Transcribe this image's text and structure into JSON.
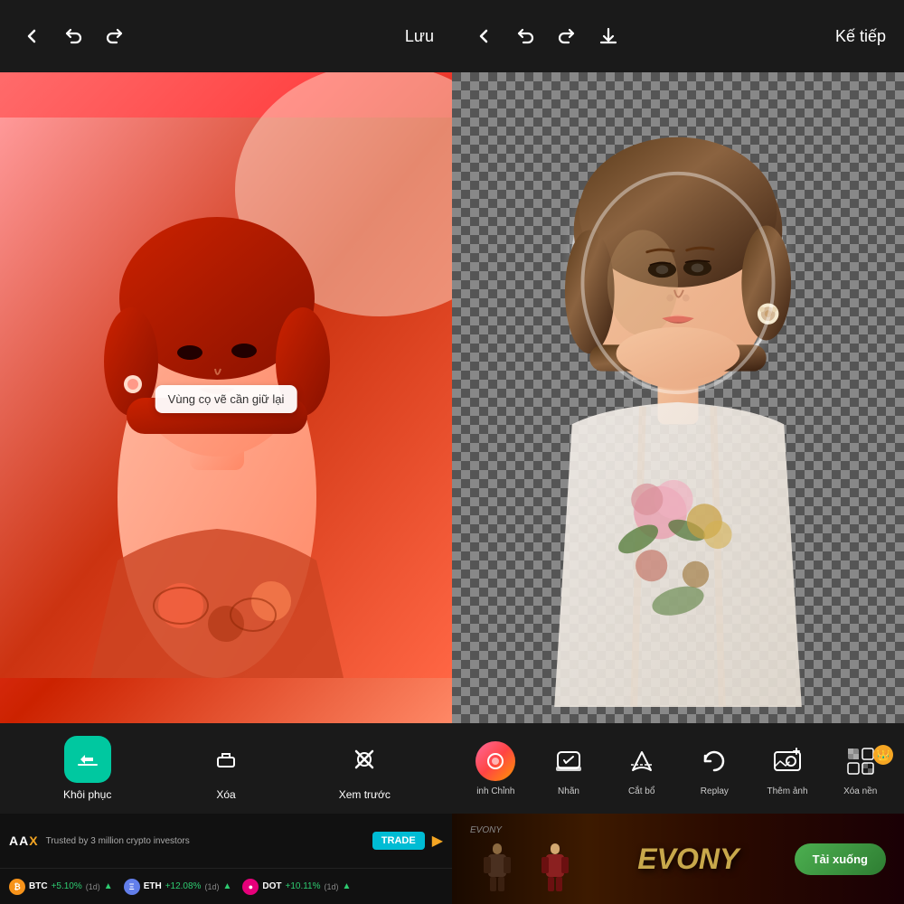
{
  "left": {
    "header": {
      "back_label": "‹",
      "undo_label": "↩",
      "redo_label": "↪",
      "save_label": "Lưu"
    },
    "tooltip": "Vùng cọ vẽ cần giữ lại",
    "toolbar": {
      "items": [
        {
          "id": "restore",
          "label": "Khôi phục",
          "icon": "✏️",
          "active": true
        },
        {
          "id": "erase",
          "label": "Xóa",
          "icon": "◈",
          "active": false
        },
        {
          "id": "preview",
          "label": "Xem trước",
          "icon": "⊘",
          "active": false
        }
      ]
    },
    "ad": {
      "logo": "AAX",
      "tagline": "Trusted by 3 million crypto investors",
      "trade_btn": "TRADE",
      "cryptos": [
        {
          "name": "BTC",
          "change": "+5.10%",
          "period": "(1d)",
          "color": "#f7931a"
        },
        {
          "name": "ETH",
          "change": "+12.08%",
          "period": "(1d)",
          "color": "#627eea"
        },
        {
          "name": "DOT",
          "change": "+10.11%",
          "period": "(1d)",
          "color": "#e6007a"
        }
      ]
    }
  },
  "right": {
    "header": {
      "back_label": "‹",
      "undo_label": "↩",
      "redo_label": "↪",
      "save_label": "⬇",
      "next_label": "Kế tiếp"
    },
    "toolbar": {
      "items": [
        {
          "id": "adjust",
          "label": "inh Chỉnh",
          "icon": "circle"
        },
        {
          "id": "stamp",
          "label": "Nhãn",
          "icon": "🏷"
        },
        {
          "id": "cutout",
          "label": "Cắt bổ",
          "icon": "✂"
        },
        {
          "id": "replay",
          "label": "Replay",
          "icon": "↻"
        },
        {
          "id": "add-photo",
          "label": "Thêm ảnh",
          "icon": "🖼"
        },
        {
          "id": "remove-bg",
          "label": "Xóa nền",
          "icon": "⊞"
        }
      ]
    },
    "ad": {
      "game_title": "EVONY",
      "download_label": "Tải xuống"
    }
  }
}
